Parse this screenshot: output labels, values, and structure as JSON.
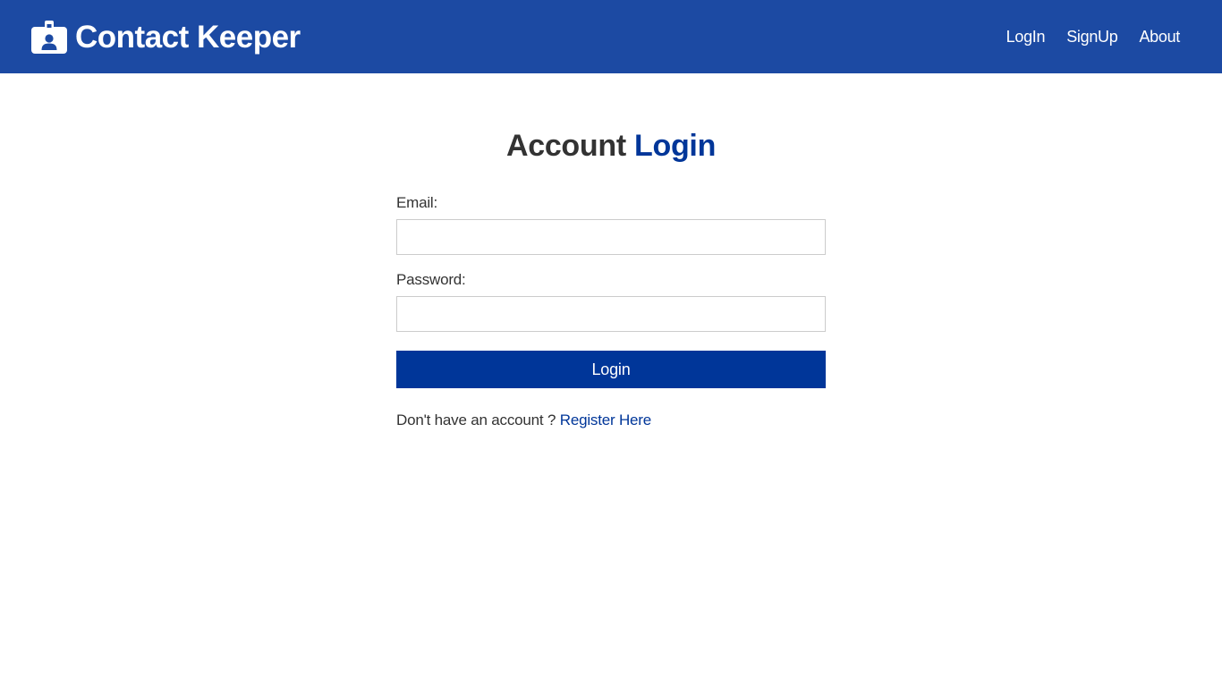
{
  "header": {
    "brand_icon": "id-badge-icon",
    "brand_title": "Contact Keeper",
    "nav": [
      {
        "label": "LogIn"
      },
      {
        "label": "SignUp"
      },
      {
        "label": "About"
      }
    ],
    "background_color": "#1c4aa3"
  },
  "login": {
    "title_prefix": "Account",
    "title_accent": "Login",
    "email_label": "Email:",
    "email_value": "",
    "password_label": "Password:",
    "password_value": "",
    "submit_label": "Login",
    "register_prompt": "Don't have an account ?",
    "register_link": "Register Here",
    "accent_color": "#003699"
  }
}
